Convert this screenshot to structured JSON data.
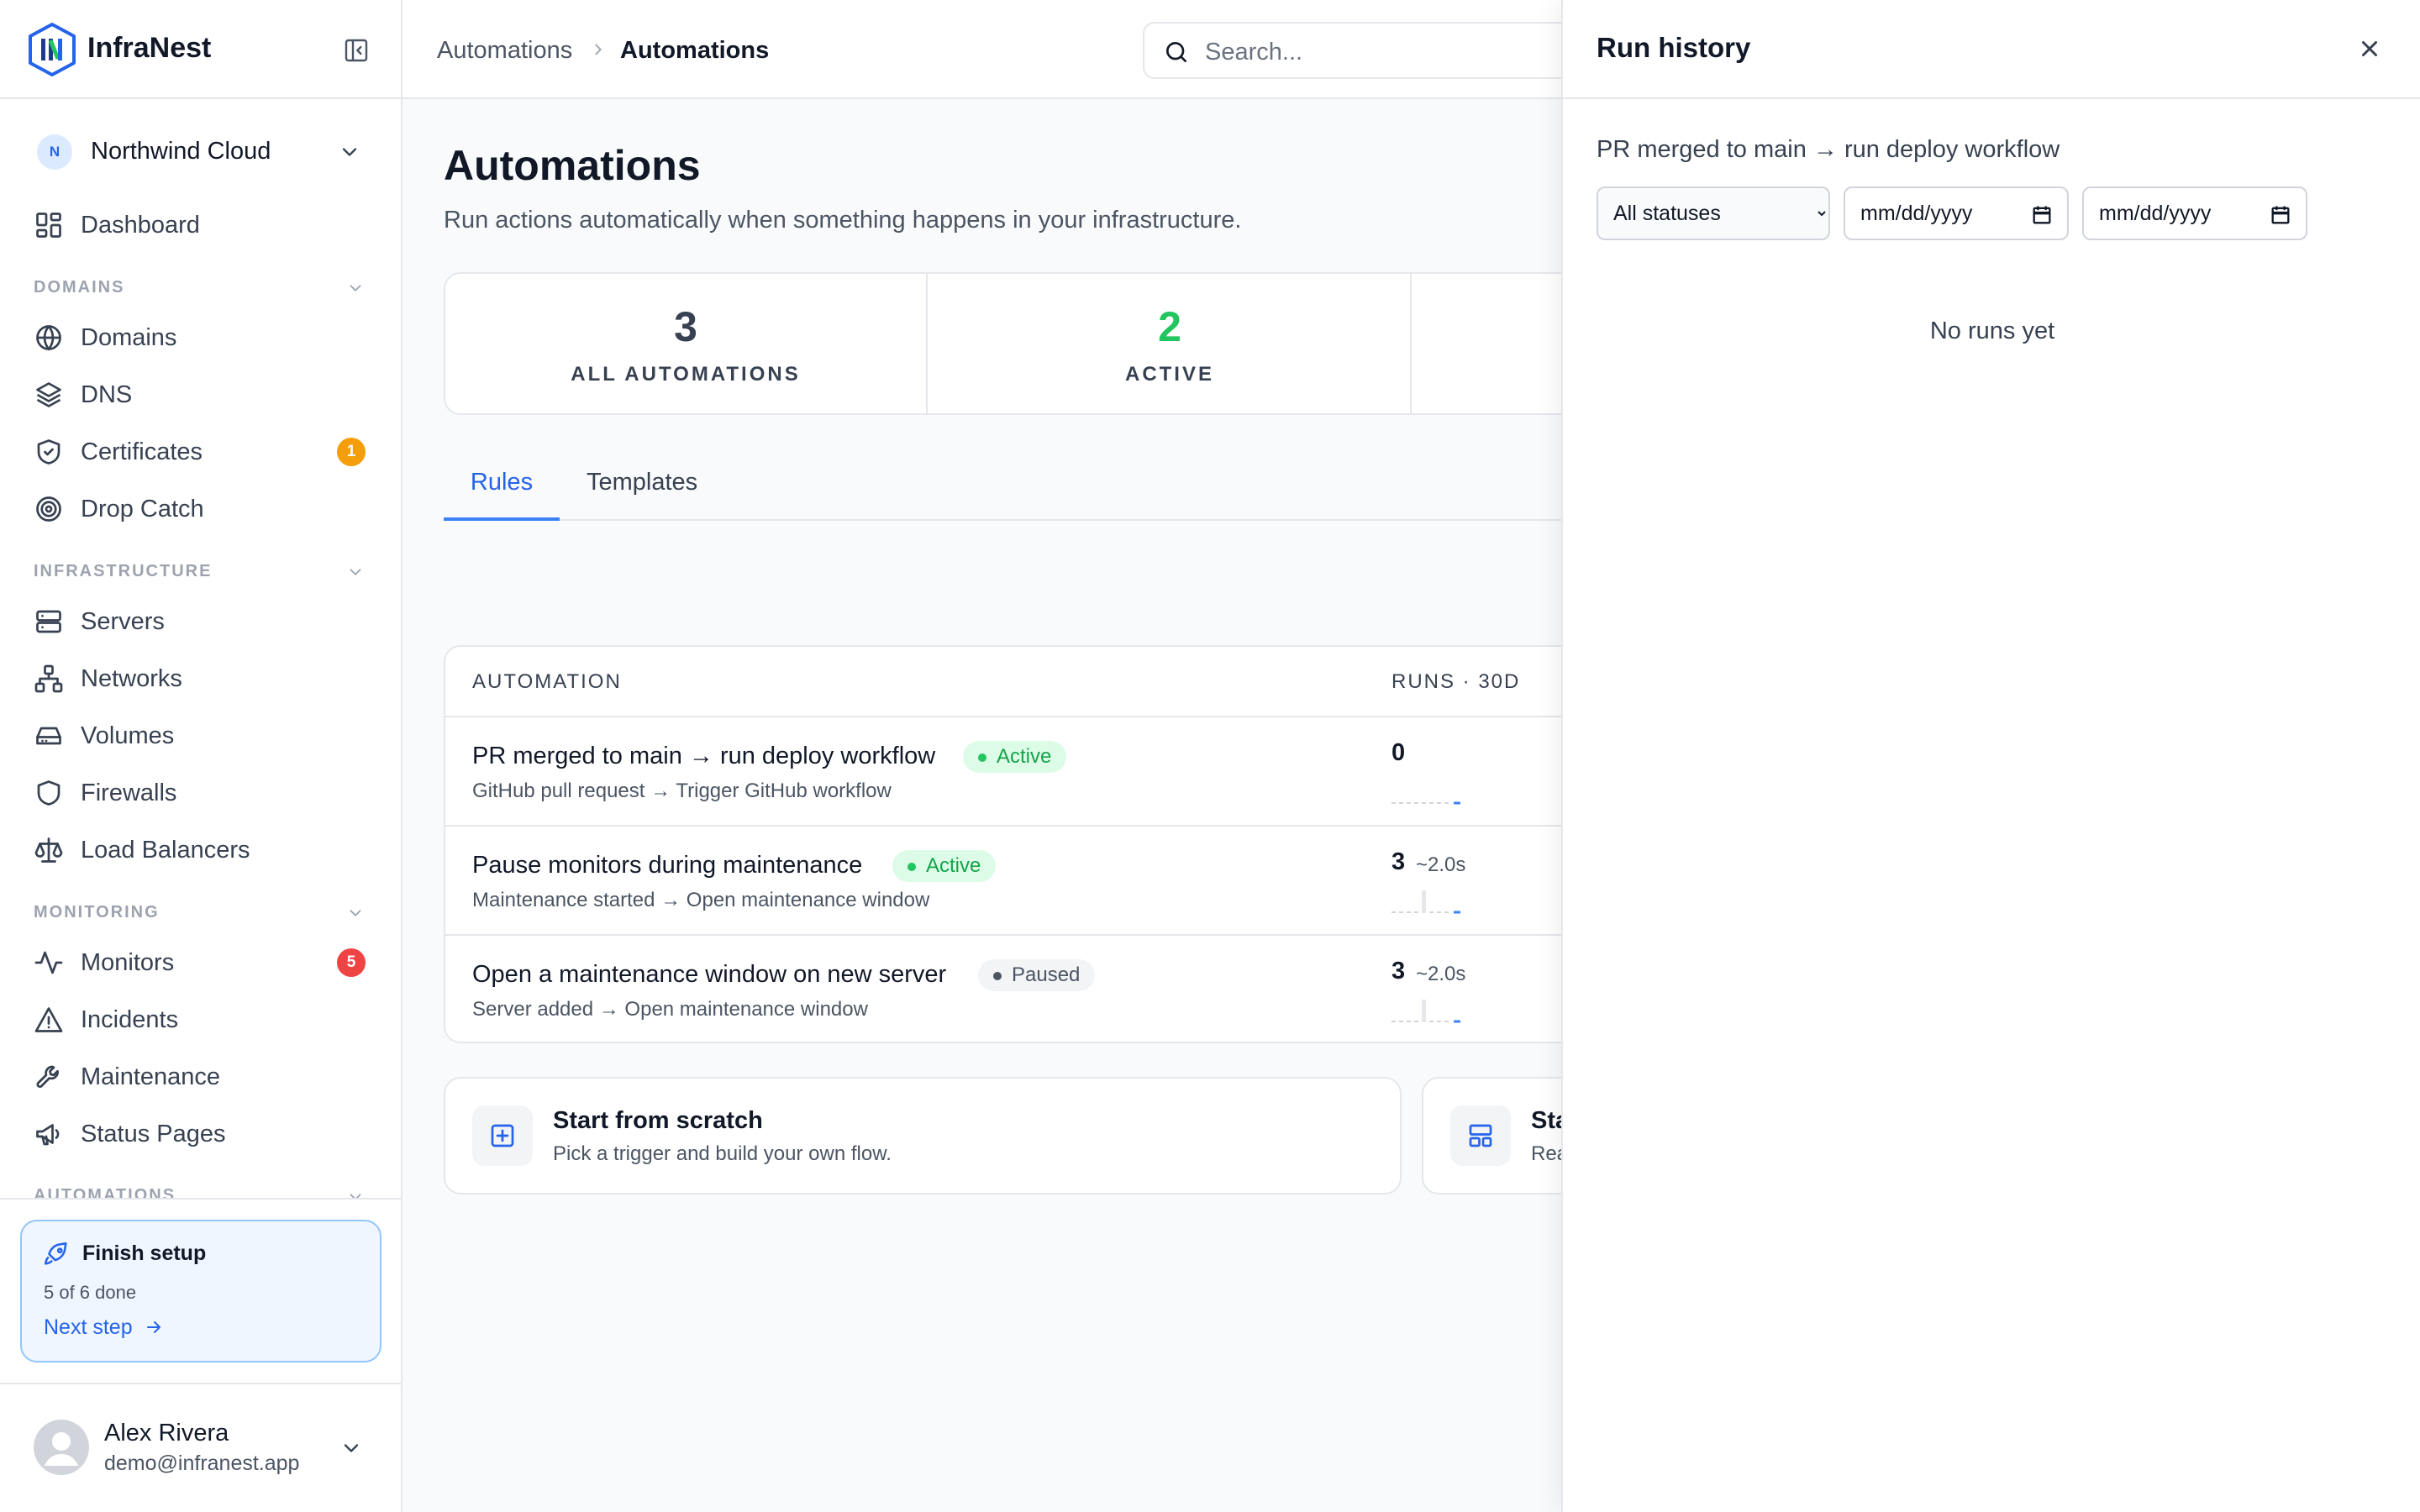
{
  "brand": {
    "name": "InfraNest"
  },
  "org": {
    "initial": "N",
    "name": "Northwind Cloud"
  },
  "nav": {
    "dashboard": "Dashboard",
    "sections": {
      "domains": "DOMAINS",
      "infrastructure": "INFRASTRUCTURE",
      "monitoring": "MONITORING",
      "automations": "AUTOMATIONS"
    },
    "domains": "Domains",
    "dns": "DNS",
    "certificates": "Certificates",
    "certificates_badge": "1",
    "drop_catch": "Drop Catch",
    "servers": "Servers",
    "networks": "Networks",
    "volumes": "Volumes",
    "firewalls": "Firewalls",
    "load_balancers": "Load Balancers",
    "monitors": "Monitors",
    "monitors_badge": "5",
    "incidents": "Incidents",
    "maintenance": "Maintenance",
    "status_pages": "Status Pages"
  },
  "setup": {
    "title": "Finish setup",
    "progress": "5 of 6 done",
    "link": "Next step"
  },
  "user": {
    "name": "Alex Rivera",
    "email": "demo@infranest.app"
  },
  "header": {
    "breadcrumb_parent": "Automations",
    "breadcrumb_current": "Automations",
    "search_placeholder": "Search..."
  },
  "page": {
    "title": "Automations",
    "subtitle": "Run actions automatically when something happens in your infrastructure."
  },
  "stats": [
    {
      "value": "3",
      "label": "ALL AUTOMATIONS"
    },
    {
      "value": "2",
      "label": "ACTIVE"
    }
  ],
  "tabs": {
    "rules": "Rules",
    "templates": "Templates"
  },
  "table": {
    "columns": {
      "automation": "AUTOMATION",
      "runs": "RUNS · 30D"
    },
    "rows": [
      {
        "name": "PR merged to main → run deploy workflow",
        "status": "Active",
        "desc": "GitHub pull request → Trigger GitHub workflow",
        "runs": "0",
        "avg": ""
      },
      {
        "name": "Pause monitors during maintenance",
        "status": "Active",
        "desc": "Maintenance started → Open maintenance window",
        "runs": "3",
        "avg": "~2.0s"
      },
      {
        "name": "Open a maintenance window on new server",
        "status": "Paused",
        "desc": "Server added → Open maintenance window",
        "runs": "3",
        "avg": "~2.0s"
      }
    ]
  },
  "cards": [
    {
      "title": "Start from scratch",
      "subtitle": "Pick a trigger and build your own flow."
    },
    {
      "title": "Sta",
      "subtitle": "Rea"
    }
  ],
  "drawer": {
    "title": "Run history",
    "subtitle": "PR merged to main → run deploy workflow",
    "status_filter": "All statuses",
    "date_from": "mm/dd/yyyy",
    "date_to": "mm/dd/yyyy",
    "empty": "No runs yet"
  },
  "colors": {
    "accent": "#2563eb",
    "active_green": "#22c55e",
    "badge_orange": "#f59e0b",
    "badge_red": "#ef4444"
  }
}
